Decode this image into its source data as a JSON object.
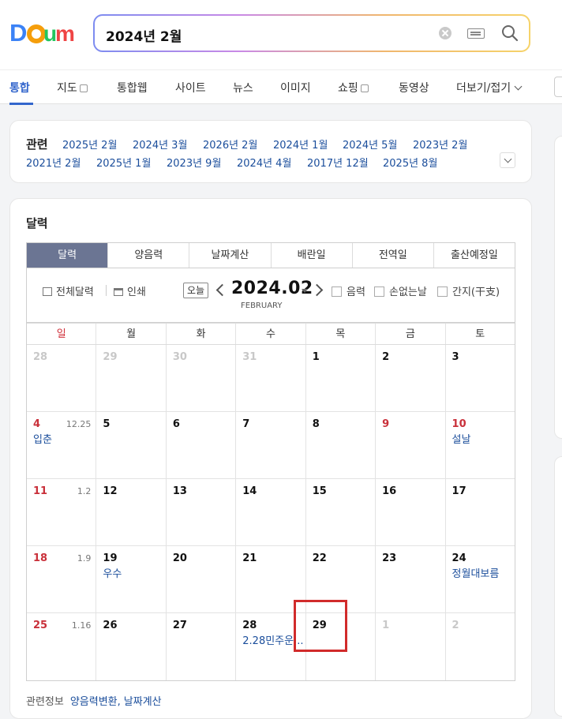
{
  "search": {
    "query": "2024년 2월"
  },
  "nav_tabs": [
    {
      "label": "통합"
    },
    {
      "label": "지도"
    },
    {
      "label": "통합웹"
    },
    {
      "label": "사이트"
    },
    {
      "label": "뉴스"
    },
    {
      "label": "이미지"
    },
    {
      "label": "쇼핑"
    },
    {
      "label": "동영상"
    },
    {
      "label": "더보기/접기"
    }
  ],
  "related": {
    "title": "관련",
    "links": [
      "2025년 2월",
      "2024년 3월",
      "2026년 2월",
      "2024년 1월",
      "2024년 5월",
      "2023년 2월",
      "2021년 2월",
      "2025년 1월",
      "2023년 9월",
      "2024년 4월",
      "2017년 12월",
      "2025년 8월"
    ]
  },
  "calendar": {
    "title": "달력",
    "subtabs": [
      "달력",
      "양음력",
      "날짜계산",
      "배란일",
      "전역일",
      "출산예정일"
    ],
    "full_calendar": "전체달력",
    "print": "인쇄",
    "today": "오늘",
    "month": "2024.02",
    "month_en": "FEBRUARY",
    "options": [
      "음력",
      "손없는날",
      "간지(干支)"
    ],
    "days_of_week": [
      "일",
      "월",
      "화",
      "수",
      "목",
      "금",
      "토"
    ],
    "weeks": [
      [
        {
          "d": "28"
        },
        {
          "d": "29"
        },
        {
          "d": "30"
        },
        {
          "d": "31"
        },
        {
          "d": "1"
        },
        {
          "d": "2"
        },
        {
          "d": "3"
        }
      ],
      [
        {
          "d": "4",
          "lunar": "12.25",
          "evt": "입춘"
        },
        {
          "d": "5"
        },
        {
          "d": "6"
        },
        {
          "d": "7"
        },
        {
          "d": "8"
        },
        {
          "d": "9"
        },
        {
          "d": "10",
          "evt": "설날"
        }
      ],
      [
        {
          "d": "11",
          "lunar": "1.2"
        },
        {
          "d": "12"
        },
        {
          "d": "13"
        },
        {
          "d": "14"
        },
        {
          "d": "15"
        },
        {
          "d": "16"
        },
        {
          "d": "17"
        }
      ],
      [
        {
          "d": "18",
          "lunar": "1.9"
        },
        {
          "d": "19",
          "evt": "우수"
        },
        {
          "d": "20"
        },
        {
          "d": "21"
        },
        {
          "d": "22"
        },
        {
          "d": "23"
        },
        {
          "d": "24",
          "evt": "정월대보름"
        }
      ],
      [
        {
          "d": "25",
          "lunar": "1.16"
        },
        {
          "d": "26"
        },
        {
          "d": "27"
        },
        {
          "d": "28",
          "evt": "2.28민주운..."
        },
        {
          "d": "29"
        },
        {
          "d": "1"
        },
        {
          "d": "2"
        }
      ]
    ],
    "related_info_label": "관련정보",
    "related_info_links": [
      "양음력변환,",
      "날짜계산"
    ]
  },
  "colors": {
    "accent": "#3366cc",
    "holiday": "#c9303a",
    "highlight_box": "#d12b2b",
    "active_subtab": "#6b7593"
  }
}
